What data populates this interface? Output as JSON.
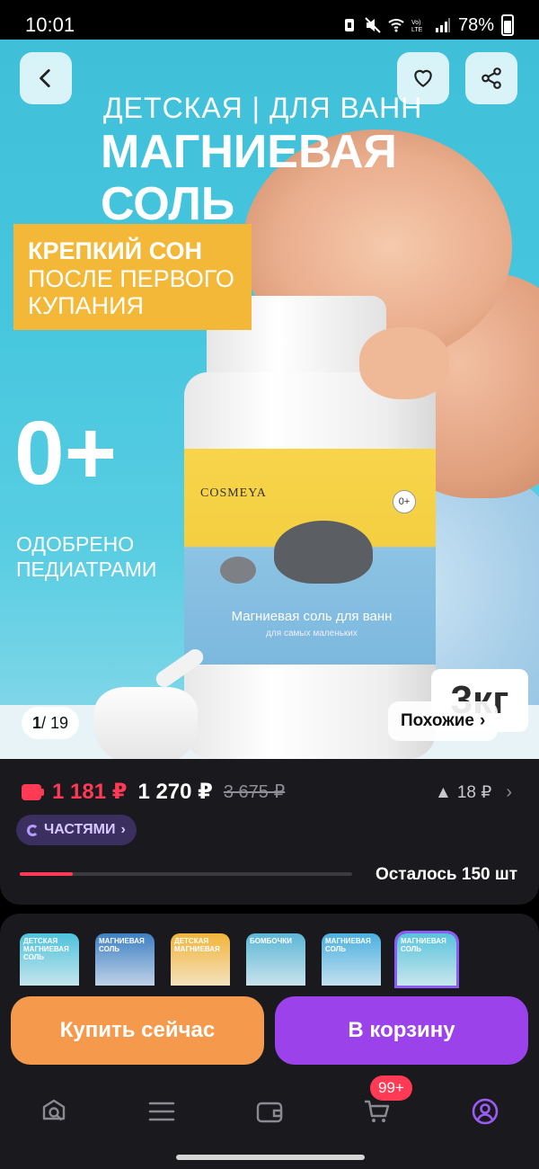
{
  "status_bar": {
    "time": "10:01",
    "battery": "78%",
    "icons": [
      "battery-saver-icon",
      "mute-icon",
      "wifi-icon",
      "volte-icon",
      "signal-icon"
    ]
  },
  "hero": {
    "line1": "ДЕТСКАЯ  |  ДЛЯ ВАНН",
    "line2": "МАГНИЕВАЯ",
    "line3": "СОЛЬ",
    "promo_line1": "КРЕПКИЙ СОН",
    "promo_line2": "ПОСЛЕ ПЕРВОГО",
    "promo_line3": "КУПАНИЯ",
    "age_big": "0+",
    "age_caption1": "ОДОБРЕНО",
    "age_caption2": "ПЕДИАТРАМИ",
    "jar_brand": "COSMEYA",
    "jar_age": "0+",
    "jar_title": "Магниевая соль для ванн",
    "jar_subtitle": "для самых маленьких",
    "weight": "3кг",
    "counter_current": "1",
    "counter_total": "/ 19",
    "similar_label": "Похожие",
    "similar_chevron": "›"
  },
  "price": {
    "card_price": "1 181 ₽",
    "price": "1 270 ₽",
    "old_price": "3 675 ₽",
    "cashback": "18 ₽",
    "cashback_arrow": "▲",
    "chevron": "›",
    "parts_label": "ЧАСТЯМИ",
    "parts_chevron": "›",
    "stock_text": "Осталось 150 шт",
    "stock_fraction": 0.16
  },
  "thumbs": [
    {
      "label": "ДЕТСКАЯ МАГНИЕВАЯ СОЛЬ",
      "color": "#4fc2dc"
    },
    {
      "label": "МАГНИЕВАЯ СОЛЬ",
      "color": "#3d7fc4"
    },
    {
      "label": "ДЕТСКАЯ МАГНИЕВАЯ",
      "color": "#f2b43a"
    },
    {
      "label": "БОМБОЧКИ",
      "color": "#5bb7d6"
    },
    {
      "label": "МАГНИЕВАЯ СОЛЬ",
      "color": "#4bb0e0"
    },
    {
      "label": "МАГНИЕВАЯ СОЛЬ",
      "color": "#58c3dc"
    }
  ],
  "actions": {
    "buy_now": "Купить сейчас",
    "add_to_cart": "В корзину"
  },
  "tabbar": {
    "cart_badge": "99+"
  },
  "colors": {
    "accent_red": "#ff3a55",
    "buy_orange": "#f59a4c",
    "cart_purple": "#9b42ea"
  }
}
